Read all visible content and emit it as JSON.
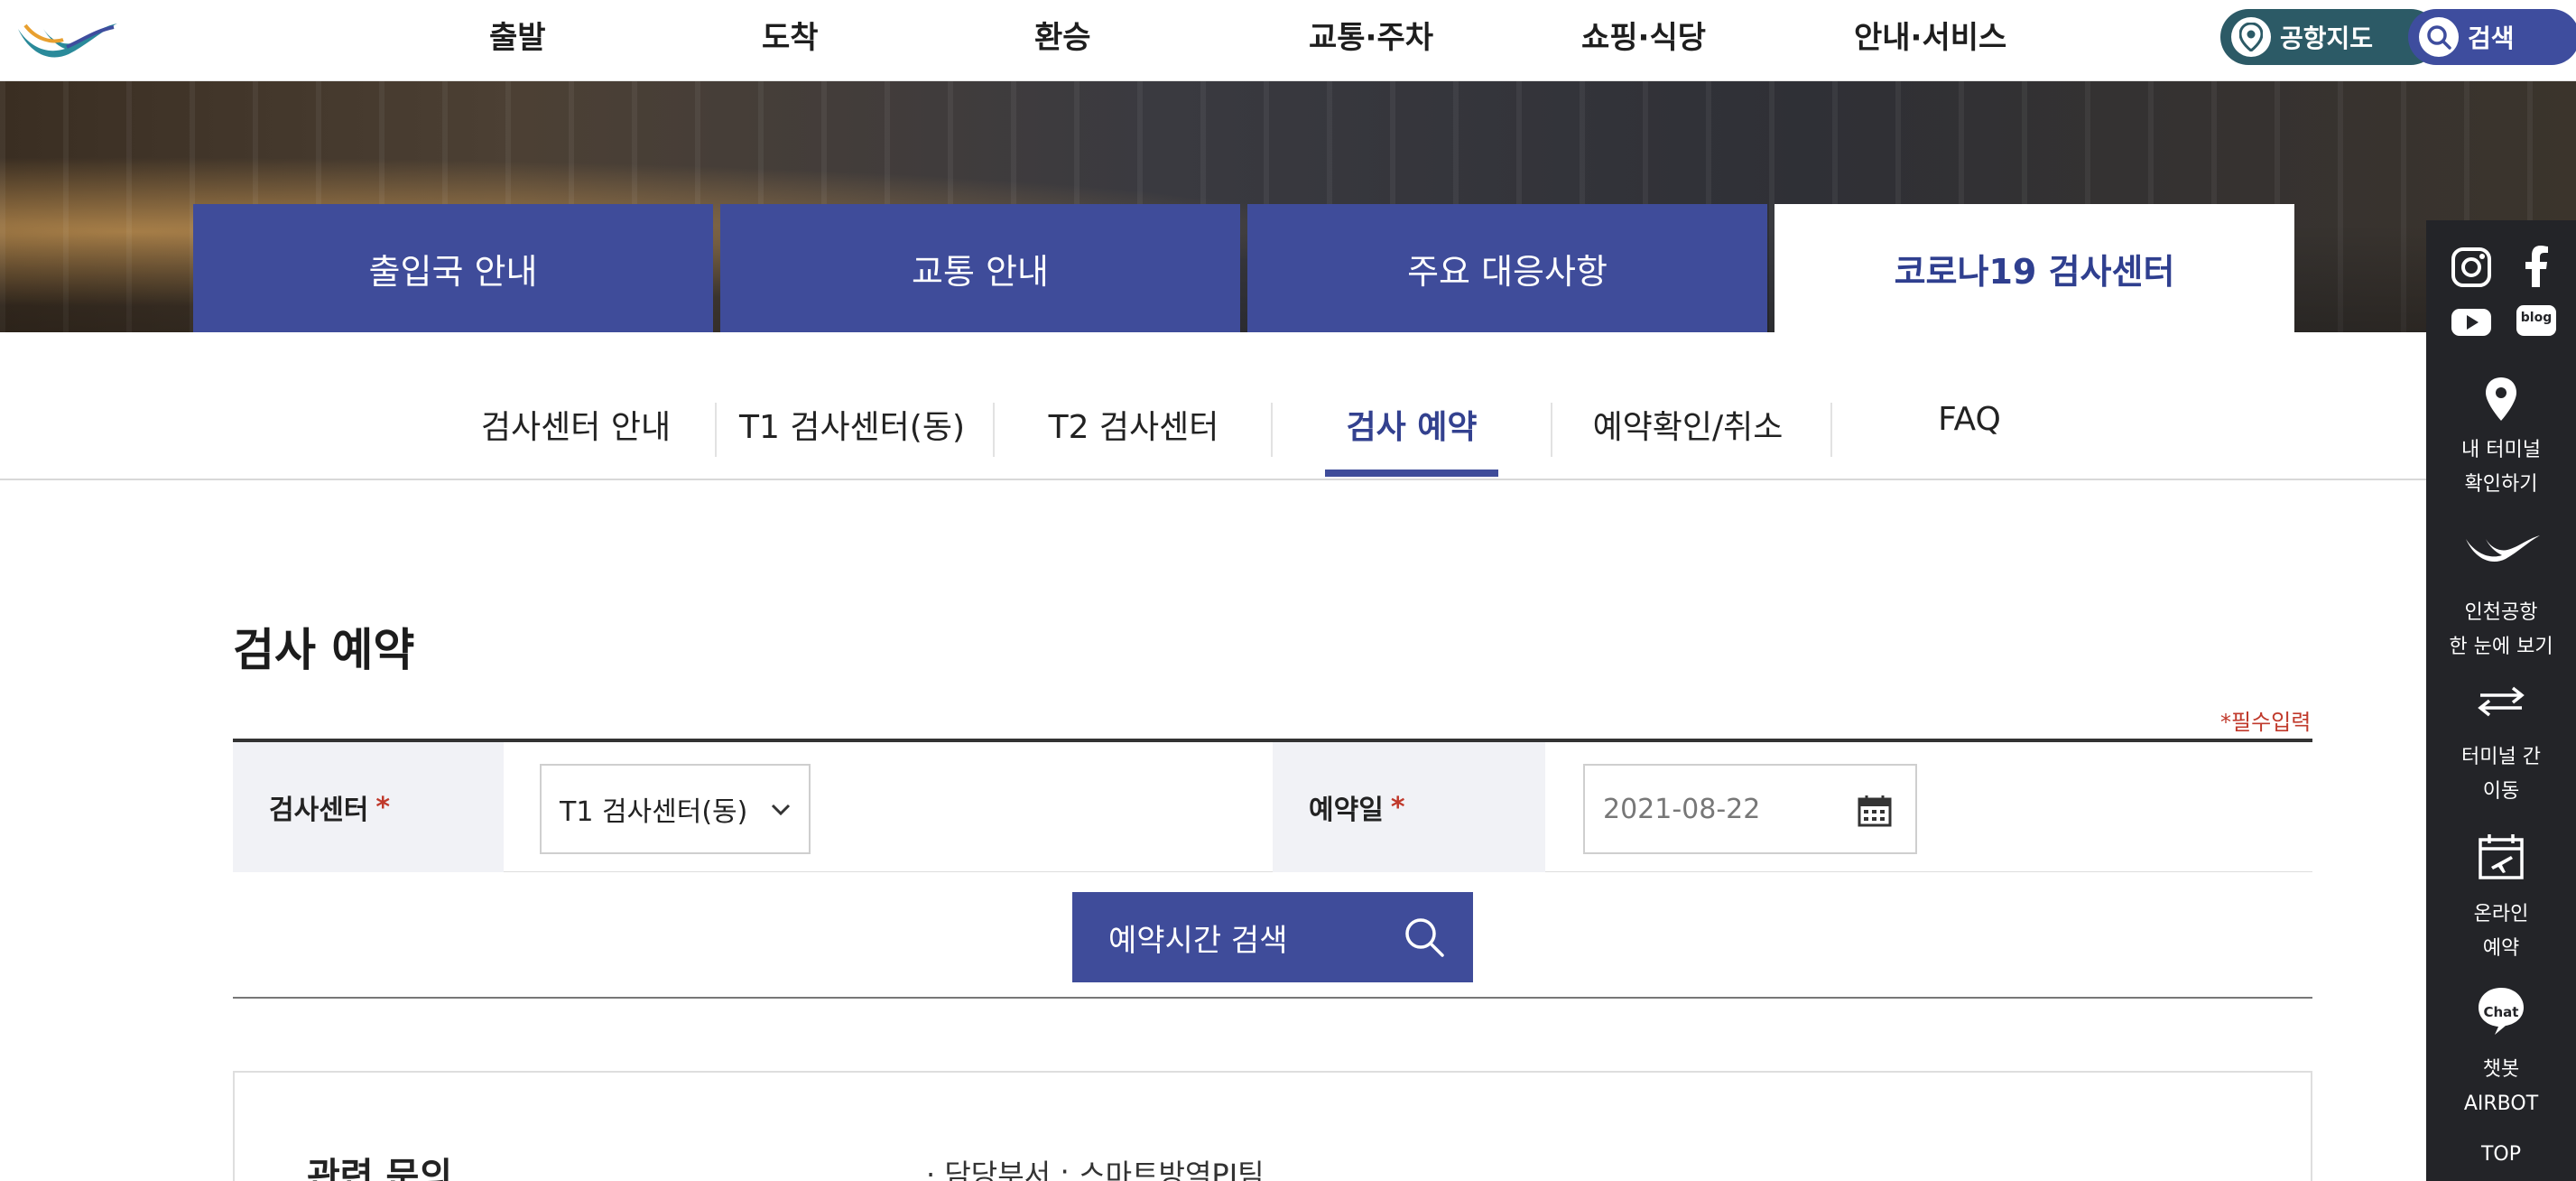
{
  "header": {
    "nav": [
      "출발",
      "도착",
      "환승",
      "교통·주차",
      "쇼핑·식당",
      "안내·서비스"
    ],
    "airport_map_label": "공항지도",
    "search_label": "검색"
  },
  "main_tabs": [
    {
      "label": "출입국 안내",
      "active": false
    },
    {
      "label": "교통 안내",
      "active": false
    },
    {
      "label": "주요 대응사항",
      "active": false
    },
    {
      "label": "코로나19 검사센터",
      "active": true
    }
  ],
  "sub_tabs": [
    {
      "label": "검사센터 안내",
      "active": false
    },
    {
      "label": "T1 검사센터(동)",
      "active": false
    },
    {
      "label": "T2 검사센터",
      "active": false
    },
    {
      "label": "검사 예약",
      "active": true
    },
    {
      "label": "예약확인/취소",
      "active": false
    },
    {
      "label": "FAQ",
      "active": false
    }
  ],
  "page": {
    "title": "검사 예약",
    "required_note": "*필수입력"
  },
  "form": {
    "center_label": "검사센터",
    "center_value": "T1 검사센터(동)",
    "date_label": "예약일",
    "date_value": "2021-08-22",
    "required_mark": "*",
    "search_button": "예약시간 검색"
  },
  "inquiry": {
    "title": "관련 문의",
    "dept": "· 담당부서 : 스마트방역PJ팀"
  },
  "quickbar": {
    "terminal_line1": "내 터미널",
    "terminal_line2": "확인하기",
    "glance_line1": "인천공항",
    "glance_line2": "한 눈에 보기",
    "transfer_line1": "터미널 간",
    "transfer_line2": "이동",
    "reserve_line1": "온라인",
    "reserve_line2": "예약",
    "chatbot_line1": "챗봇",
    "chatbot_line2": "AIRBOT",
    "chat_icon_text": "Chat",
    "blog_icon_text": "blog",
    "top_label": "TOP"
  },
  "colors": {
    "primary": "#3f4c9a",
    "map_pill": "#2c5a66",
    "quickbar_bg": "#232428",
    "required": "#c0392b"
  }
}
